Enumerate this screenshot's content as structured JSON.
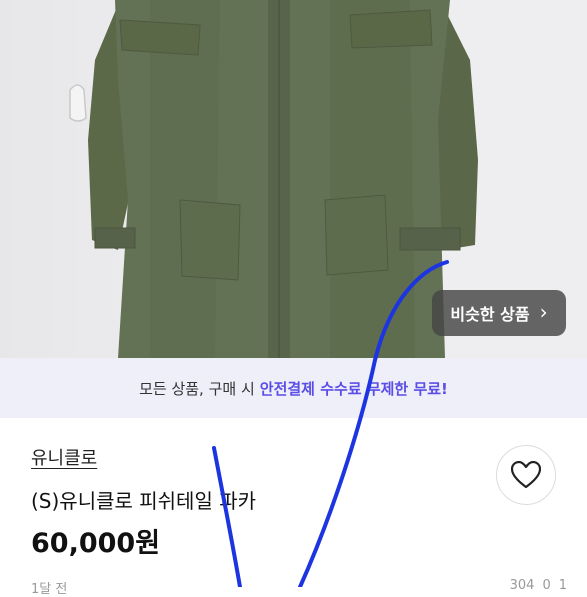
{
  "product": {
    "shop_name": "유니클로",
    "title": "(S)유니클로 피쉬테일 파카",
    "price": "60,000원",
    "similar_button_label": "비슷한 상품",
    "posted_ago": "1달 전",
    "stats": [
      "304",
      "0",
      "1"
    ]
  },
  "banner": {
    "text_prefix": "모든 상품, 구매 시",
    "text_accent": "안전결제 수수료 무제한 무료!"
  },
  "colors": {
    "accent": "#5b4ee6",
    "banner_bg": "#eeeff8",
    "jacket": "#5c6a4a",
    "scribble": "#1d35e0"
  },
  "icons": {
    "like": "heart-outline-icon",
    "similar": "chevron-right-icon"
  }
}
